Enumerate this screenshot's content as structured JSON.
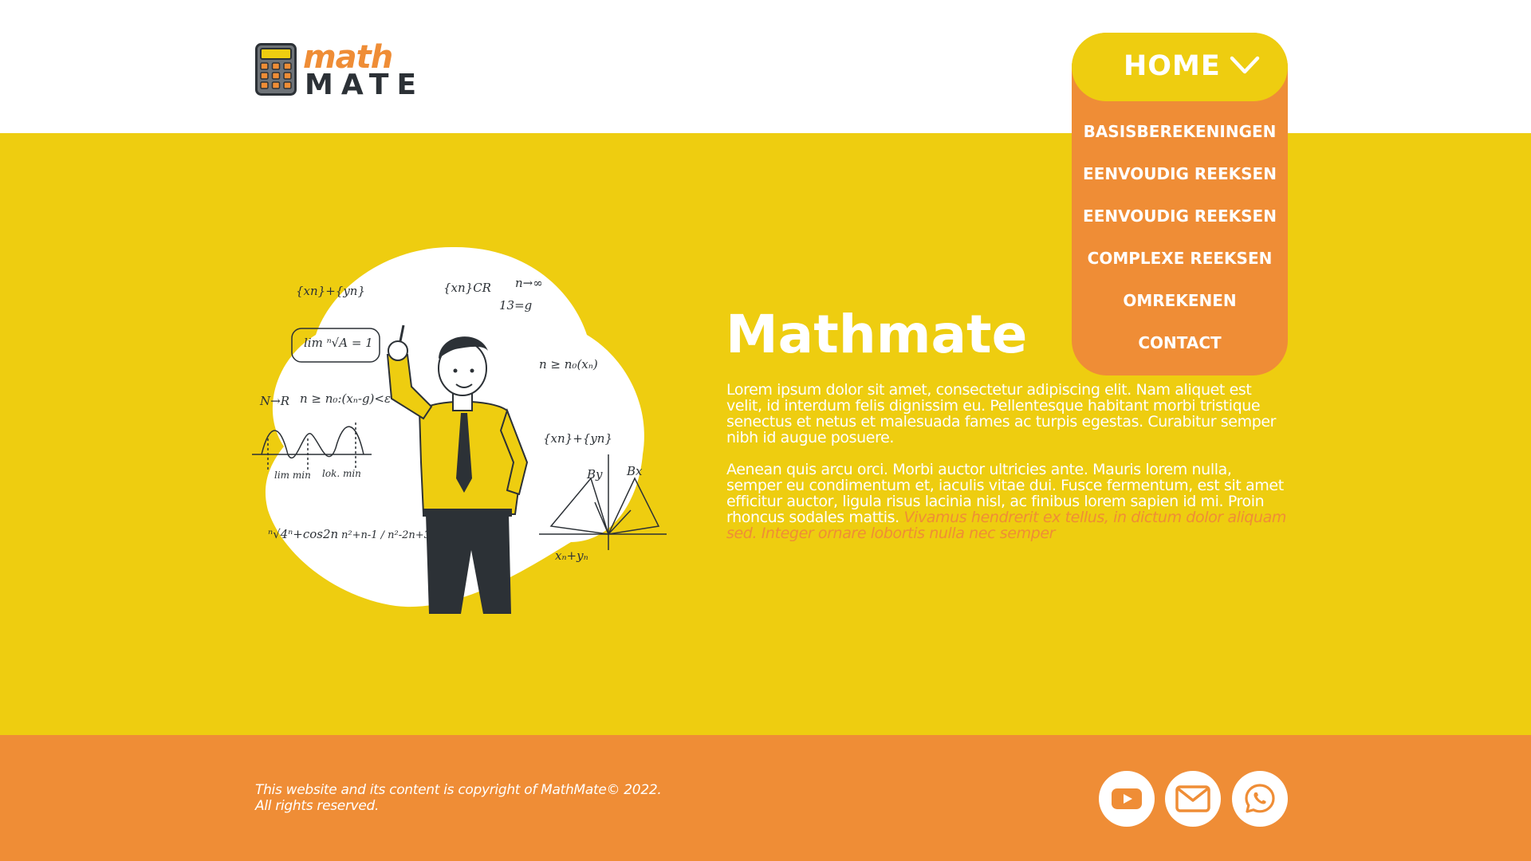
{
  "brand": {
    "logo_top": "math",
    "logo_bottom": "MATE",
    "calculator_icon": "calculator-icon"
  },
  "nav": {
    "current": "HOME",
    "items": [
      {
        "label": "BASISBEREKENINGEN"
      },
      {
        "label": "EENVOUDIG REEKSEN"
      },
      {
        "label": "EENVOUDIG REEKSEN"
      },
      {
        "label": "COMPLEXE REEKSEN"
      },
      {
        "label": "OMREKENEN"
      },
      {
        "label": "CONTACT"
      }
    ]
  },
  "hero": {
    "title": "Mathmate",
    "paragraph1": "Lorem ipsum dolor sit amet, consectetur adipiscing elit. Nam aliquet est velit, id interdum felis dignissim eu. Pellentesque habitant morbi tristique senectus et netus et malesuada fames ac turpis egestas. Curabitur semper nibh id augue posuere.",
    "paragraph2": "Aenean quis arcu orci. Morbi auctor ultricies ante. Mauris lorem nulla, semper eu condimentum et, iaculis vitae dui. Fusce fermentum, est sit amet efficitur auctor, ligula risus lacinia nisl, ac finibus lorem sapien id mi. Proin rhoncus sodales mattis.",
    "paragraph2_accent": "Vivamus hendrerit ex tellus, in dictum dolor aliquam sed. Integer ornare lobortis nulla nec semper",
    "illustration": {
      "formulas": [
        "{xn}+{yn}",
        "{xn}CR",
        "n→∞",
        "lim ⁿ√A = 1",
        "N→R",
        "n ≥ n₀:(xₙ-g)<ε",
        "n ≥ n₀(xₙ)",
        "{xn}+{yn}",
        "By",
        "Bx",
        "lim min",
        "lok. min",
        "ⁿ√4ⁿ+cos2n",
        "n²+n-1 / n²-2n+3",
        "13=g",
        "xₙ+yₙ"
      ]
    }
  },
  "footer": {
    "copyright_line1": "This website and its content is copyright of MathMate© 2022.",
    "copyright_line2": "All rights reserved.",
    "social": [
      {
        "name": "youtube-icon"
      },
      {
        "name": "mail-icon"
      },
      {
        "name": "whatsapp-icon"
      }
    ]
  },
  "colors": {
    "yellow": "#eecd10",
    "orange": "#ef8d36",
    "dark": "#2c3136",
    "white": "#ffffff"
  }
}
